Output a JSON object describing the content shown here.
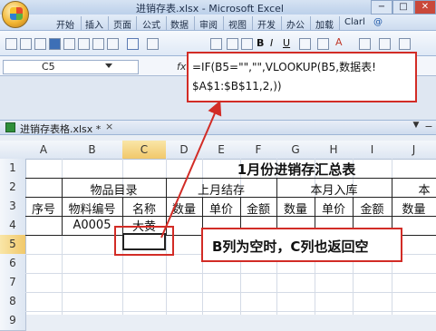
{
  "window": {
    "title": "进销存表.xlsx - Microsoft Excel",
    "controls": [
      "−",
      "□",
      "✕"
    ]
  },
  "quick_access": {
    "undo_label": "↶ ↷"
  },
  "ribbon": {
    "tabs": [
      "开始",
      "插入",
      "页面",
      "公式",
      "数据",
      "审阅",
      "视图",
      "开发",
      "办公",
      "加载",
      "Clarl"
    ]
  },
  "formula_bar": {
    "name_box": "C5",
    "fx_label": "fx",
    "formula_line1": "=IF(B5=\"\",\"\",VLOOKUP(B5,数据表!",
    "formula_line2": "$A$1:$B$11,2,))"
  },
  "workbook_tab": {
    "name": "进销存表格.xlsx *",
    "close": "×"
  },
  "sheet": {
    "columns": [
      "A",
      "B",
      "C",
      "D",
      "E",
      "F",
      "G",
      "H",
      "I",
      "J"
    ],
    "rows": [
      "1",
      "2",
      "3",
      "4",
      "5",
      "6",
      "7",
      "8",
      "9"
    ],
    "title": "1月份进销存汇总表",
    "group_headers": {
      "items": "物品目录",
      "last_month": "上月结存",
      "this_month_in": "本月入库",
      "partial": "本"
    },
    "col_headers": [
      "序号",
      "物料编号",
      "名称",
      "数量",
      "单价",
      "金额",
      "数量",
      "单价",
      "金额",
      "数量"
    ],
    "row4": {
      "code": "A0005",
      "name": "大黄"
    }
  },
  "annotation": {
    "text": "B列为空时，C列也返回空"
  },
  "colors": {
    "accent_red": "#d22c26"
  }
}
